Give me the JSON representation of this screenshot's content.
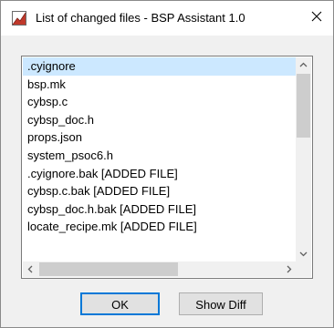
{
  "window": {
    "title": "List of changed files - BSP Assistant 1.0",
    "close_glyph": "✕"
  },
  "files": [
    ".cyignore",
    "bsp.mk",
    "cybsp.c",
    "cybsp_doc.h",
    "props.json",
    "system_psoc6.h",
    ".cyignore.bak [ADDED FILE]",
    "cybsp.c.bak [ADDED FILE]",
    "cybsp_doc.h.bak [ADDED FILE]",
    "locate_recipe.mk [ADDED FILE]"
  ],
  "selected_index": 0,
  "buttons": {
    "ok_label": "OK",
    "show_diff_label": "Show Diff"
  },
  "colors": {
    "selection": "#cce8ff",
    "default_button_border": "#0078d7",
    "app_icon_red": "#c0392b"
  },
  "icons": {
    "app": "bsp-assistant-icon",
    "close": "close-icon"
  }
}
